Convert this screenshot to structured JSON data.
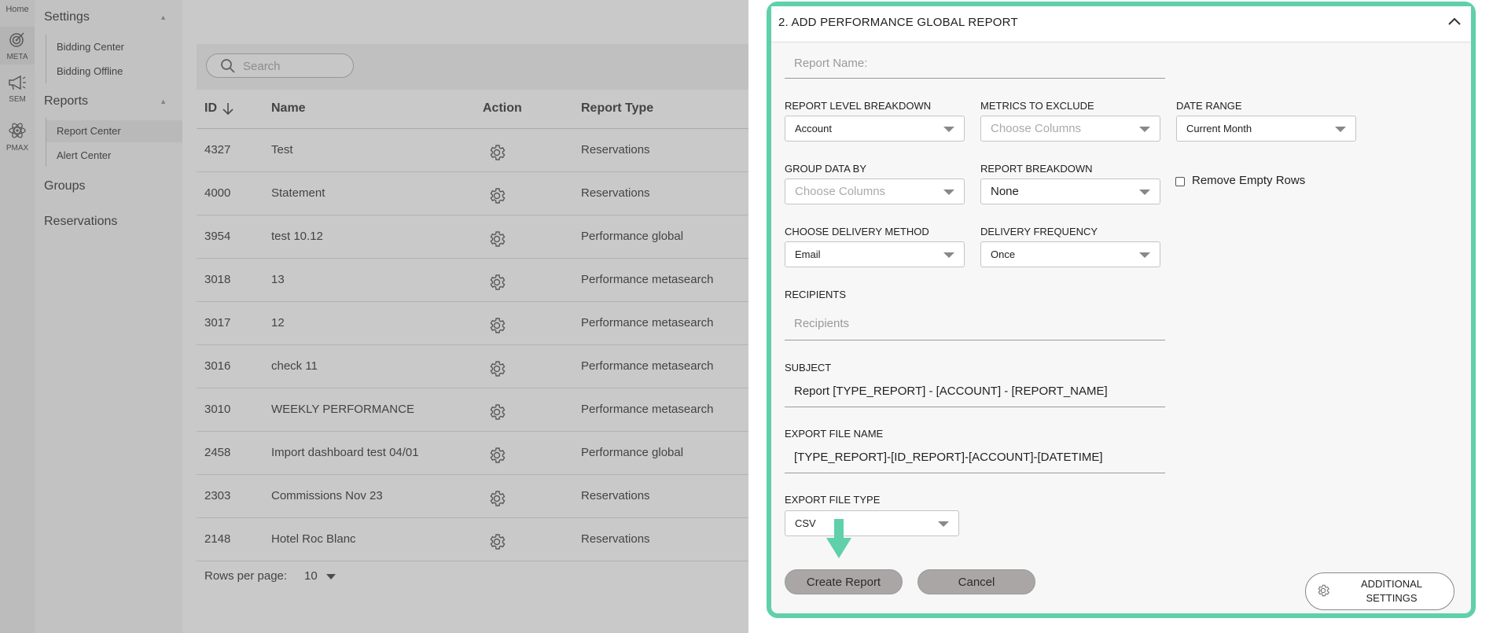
{
  "rail": {
    "home": "Home",
    "items": [
      {
        "label": "META",
        "icon": "target-icon"
      },
      {
        "label": "SEM",
        "icon": "megaphone-icon"
      },
      {
        "label": "PMAX",
        "icon": "atom-icon"
      }
    ]
  },
  "sidebar": {
    "settings": "Settings",
    "settings_items": [
      "Bidding Center",
      "Bidding Offline"
    ],
    "reports": "Reports",
    "reports_items": [
      "Report Center",
      "Alert Center"
    ],
    "groups": "Groups",
    "reservations": "Reservations"
  },
  "list": {
    "search_placeholder": "Search",
    "columns": {
      "id": "ID",
      "name": "Name",
      "action": "Action",
      "type": "Report Type"
    },
    "rows": [
      {
        "id": "4327",
        "name": "Test",
        "type": "Reservations"
      },
      {
        "id": "4000",
        "name": "Statement",
        "type": "Reservations"
      },
      {
        "id": "3954",
        "name": "test 10.12",
        "type": "Performance global"
      },
      {
        "id": "3018",
        "name": "13",
        "type": "Performance metasearch"
      },
      {
        "id": "3017",
        "name": "12",
        "type": "Performance metasearch"
      },
      {
        "id": "3016",
        "name": "check 11",
        "type": "Performance metasearch"
      },
      {
        "id": "3010",
        "name": "WEEKLY PERFORMANCE",
        "type": "Performance metasearch"
      },
      {
        "id": "2458",
        "name": "Import dashboard test 04/01",
        "type": "Performance global"
      },
      {
        "id": "2303",
        "name": "Commissions Nov 23",
        "type": "Reservations"
      },
      {
        "id": "2148",
        "name": "Hotel Roc Blanc",
        "type": "Reservations"
      }
    ],
    "rows_per_page_label": "Rows per page:",
    "rows_per_page_value": "10"
  },
  "panel": {
    "title": "2. ADD PERFORMANCE GLOBAL REPORT",
    "report_name_placeholder": "Report Name:",
    "report_level_label": "REPORT LEVEL BREAKDOWN",
    "report_level_value": "Account",
    "metrics_exclude_label": "METRICS TO EXCLUDE",
    "metrics_exclude_placeholder": "Choose Columns",
    "date_range_label": "DATE RANGE",
    "date_range_value": "Current Month",
    "group_data_label": "GROUP DATA BY",
    "group_data_placeholder": "Choose Columns",
    "report_breakdown_label": "REPORT BREAKDOWN",
    "report_breakdown_value": "None",
    "remove_empty_label": "Remove Empty Rows",
    "remove_empty_checked": false,
    "delivery_method_label": "CHOOSE DELIVERY METHOD",
    "delivery_method_value": "Email",
    "delivery_freq_label": "DELIVERY FREQUENCY",
    "delivery_freq_value": "Once",
    "recipients_label": "RECIPIENTS",
    "recipients_placeholder": "Recipients",
    "subject_label": "SUBJECT",
    "subject_value": "Report [TYPE_REPORT] - [ACCOUNT] - [REPORT_NAME]",
    "export_name_label": "EXPORT FILE NAME",
    "export_name_value": "[TYPE_REPORT]-[ID_REPORT]-[ACCOUNT]-[DATETIME]",
    "export_type_label": "EXPORT FILE TYPE",
    "export_type_value": "CSV",
    "create_button": "Create Report",
    "cancel_button": "Cancel",
    "additional_settings": "ADDITIONAL SETTINGS"
  },
  "colors": {
    "accent": "#60d0aa",
    "button_gray": "#aaa6a6"
  }
}
